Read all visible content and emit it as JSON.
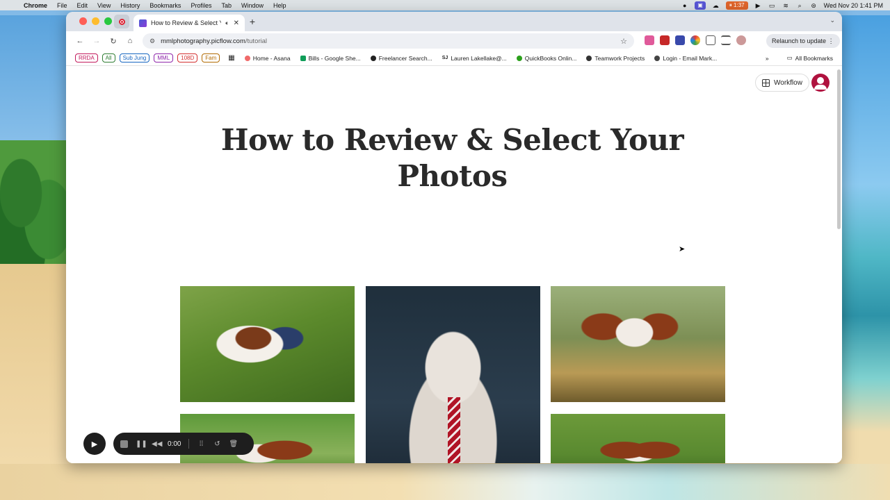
{
  "menubar": {
    "app": "Chrome",
    "items": [
      "File",
      "Edit",
      "View",
      "History",
      "Bookmarks",
      "Profiles",
      "Tab",
      "Window",
      "Help"
    ],
    "timer": "1:37",
    "datetime": "Wed Nov 20  1:41 PM"
  },
  "tab": {
    "title": "How to Review & Select Y",
    "new_tab": "+"
  },
  "toolbar": {
    "url_host": "mmlphotography.picflow.com",
    "url_path": "/tutorial",
    "relaunch_label": "Relaunch to update"
  },
  "bookmarks": {
    "tags": [
      {
        "label": "RRDA",
        "color": "#c2185b"
      },
      {
        "label": "All",
        "color": "#2e7d32"
      },
      {
        "label": "Sub Jung",
        "color": "#1565c0"
      },
      {
        "label": "MML",
        "color": "#8e24aa"
      },
      {
        "label": "108D",
        "color": "#d32f2f"
      },
      {
        "label": "Fam",
        "color": "#b26a00"
      }
    ],
    "items": [
      {
        "label": "Home - Asana",
        "color": "#f06a6a"
      },
      {
        "label": "Bills - Google She...",
        "color": "#0f9d58"
      },
      {
        "label": "Freelancer Search...",
        "color": "#222222"
      },
      {
        "label": "Lauren Lakellake@...",
        "color": "#555555"
      },
      {
        "label": "QuickBooks Onlin...",
        "color": "#2ca01c"
      },
      {
        "label": "Teamwork Projects",
        "color": "#333333"
      },
      {
        "label": "Login - Email Mark...",
        "color": "#444444"
      }
    ],
    "sj_prefix": "SJ",
    "all_bookmarks": "All Bookmarks"
  },
  "page": {
    "workflow_label": "Workflow",
    "title_line1": "How to Review & Select Your",
    "title_line2": "Photos"
  },
  "recorder": {
    "time": "0:00"
  }
}
